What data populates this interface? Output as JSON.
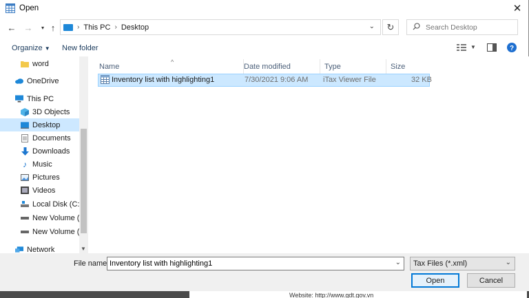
{
  "window": {
    "title": "Open"
  },
  "address": {
    "crumbs": [
      "This PC",
      "Desktop"
    ],
    "separator": "›"
  },
  "search": {
    "placeholder": "Search Desktop"
  },
  "commands": {
    "organize": "Organize",
    "new_folder": "New folder"
  },
  "nav_items": [
    {
      "label": "word",
      "icon": "folder-icon"
    },
    {
      "label": "OneDrive",
      "icon": "cloud-icon"
    },
    {
      "label": "This PC",
      "icon": "pc-icon"
    },
    {
      "label": "3D Objects",
      "icon": "cube-icon"
    },
    {
      "label": "Desktop",
      "icon": "desktop-icon"
    },
    {
      "label": "Documents",
      "icon": "document-icon"
    },
    {
      "label": "Downloads",
      "icon": "download-arrow-icon"
    },
    {
      "label": "Music",
      "icon": "music-note-icon"
    },
    {
      "label": "Pictures",
      "icon": "picture-icon"
    },
    {
      "label": "Videos",
      "icon": "video-icon"
    },
    {
      "label": "Local Disk (C:)",
      "icon": "drive-icon"
    },
    {
      "label": "New Volume (F:)",
      "icon": "drive-icon"
    },
    {
      "label": "New Volume (G:)",
      "icon": "drive-icon"
    },
    {
      "label": "Network",
      "icon": "network-icon"
    }
  ],
  "columns": {
    "name": "Name",
    "date": "Date modified",
    "type": "Type",
    "size": "Size"
  },
  "files": [
    {
      "name": "Inventory list with highlighting1",
      "date": "7/30/2021 9:06 AM",
      "type": "iTax Viewer File",
      "size": "32 KB"
    }
  ],
  "footer": {
    "file_name_label": "File name:",
    "file_name_value": "Inventory list with highlighting1",
    "filter": "Tax Files (*.xml)",
    "open": "Open",
    "cancel": "Cancel"
  },
  "background": {
    "text": "Website: http://www.gdt.gov.vn"
  },
  "colors": {
    "accent": "#0078d7",
    "selection": "#cce8ff",
    "folder": "#f3c94b",
    "pc_blue": "#1e88d8"
  }
}
